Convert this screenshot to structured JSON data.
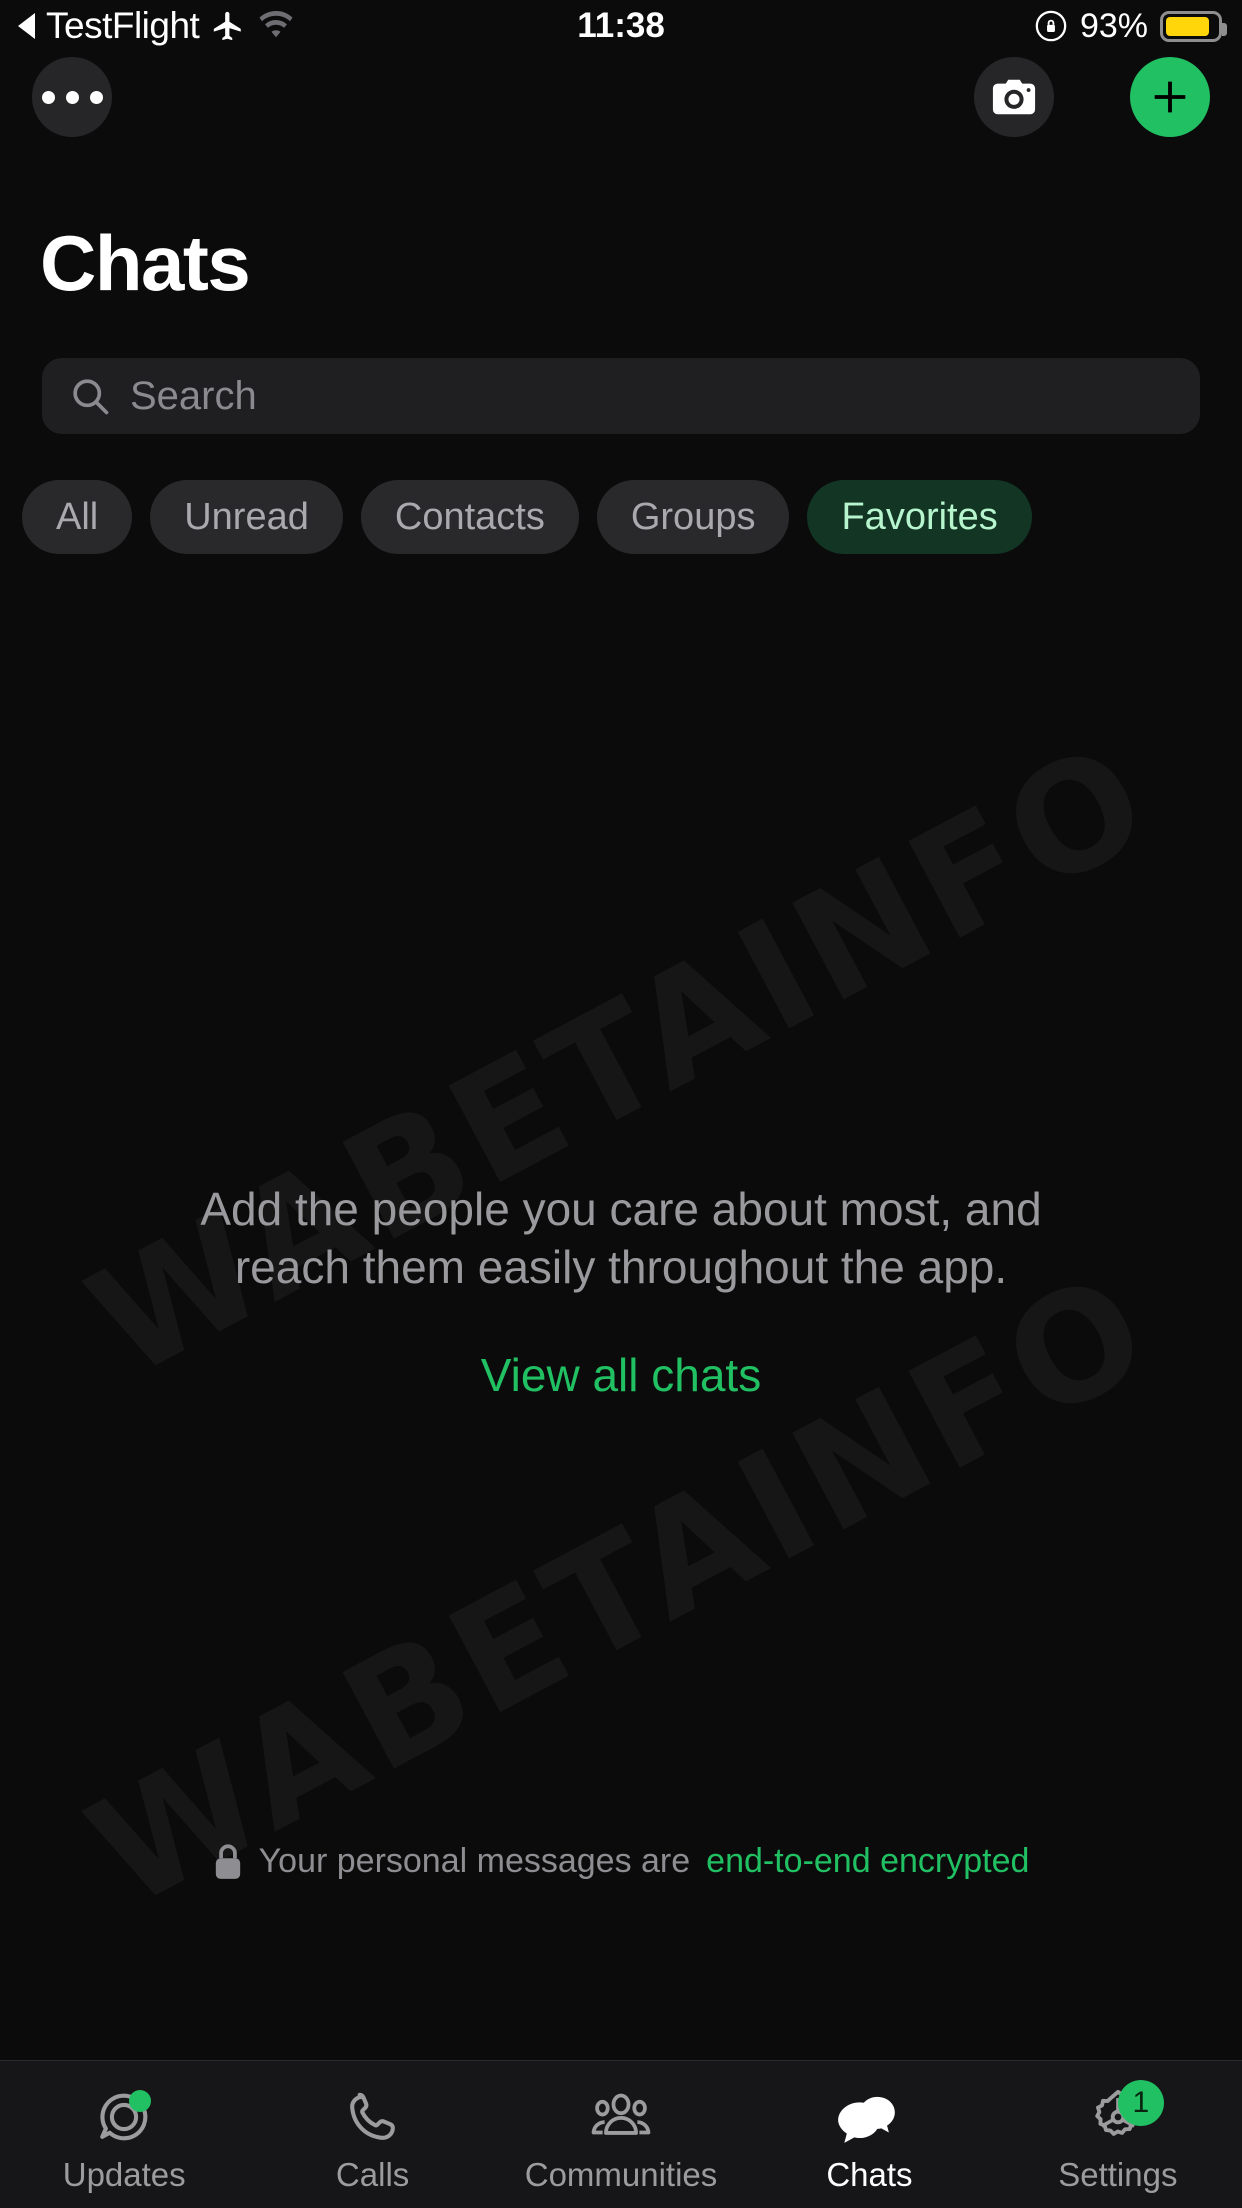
{
  "status_bar": {
    "back_app": "TestFlight",
    "icons": [
      "back-arrow-icon",
      "airplane-mode-icon",
      "wifi-icon"
    ],
    "time": "11:38",
    "rotation_lock": "rotation-lock-icon",
    "battery_percent": "93%",
    "battery_color": "#ffd60a"
  },
  "nav": {
    "more_button": "more-options",
    "camera_button": "camera",
    "new_chat_button": "new-chat",
    "accent_green": "#21c063"
  },
  "header": {
    "title": "Chats"
  },
  "search": {
    "placeholder": "Search",
    "value": ""
  },
  "filters": {
    "items": [
      {
        "label": "All",
        "active": false
      },
      {
        "label": "Unread",
        "active": false
      },
      {
        "label": "Contacts",
        "active": false
      },
      {
        "label": "Groups",
        "active": false
      },
      {
        "label": "Favorites",
        "active": true
      }
    ],
    "active_bg": "#123524",
    "active_fg": "#b6f5cd"
  },
  "empty_state": {
    "line1": "Add the people you care about most, and",
    "line2": "reach them easily throughout the app.",
    "action_label": "View all chats"
  },
  "encryption_notice": {
    "icon": "lock-icon",
    "prefix": "Your personal messages are ",
    "highlight": "end-to-end encrypted"
  },
  "watermark": {
    "text_top": "WABETAINFO",
    "text_bottom": "WABETAINFO"
  },
  "tab_bar": {
    "tabs": [
      {
        "label": "Updates",
        "icon": "updates-status-icon",
        "active": false,
        "badge_dot": true,
        "badge_count": ""
      },
      {
        "label": "Calls",
        "icon": "phone-icon",
        "active": false,
        "badge_dot": false,
        "badge_count": ""
      },
      {
        "label": "Communities",
        "icon": "communities-people-icon",
        "active": false,
        "badge_dot": false,
        "badge_count": ""
      },
      {
        "label": "Chats",
        "icon": "chat-bubbles-icon",
        "active": true,
        "badge_dot": false,
        "badge_count": ""
      },
      {
        "label": "Settings",
        "icon": "gear-icon",
        "active": false,
        "badge_dot": false,
        "badge_count": "1"
      }
    ]
  }
}
